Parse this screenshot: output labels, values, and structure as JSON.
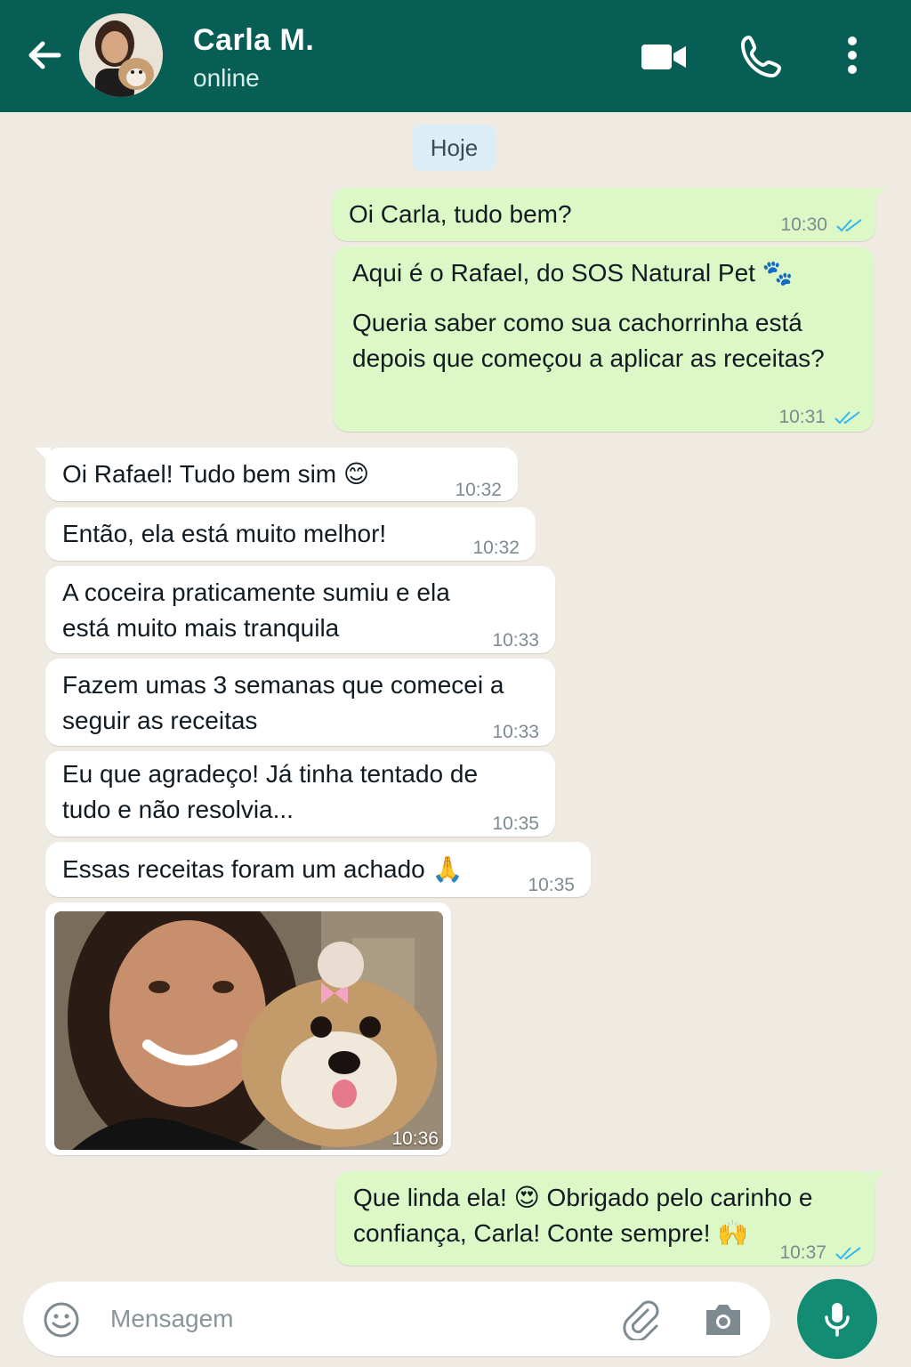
{
  "header": {
    "contact_name": "Carla M.",
    "status": "online"
  },
  "chat": {
    "date_chip": "Hoje",
    "messages": [
      {
        "dir": "out",
        "text": "Oi Carla, tudo bem?",
        "time": "10:30"
      },
      {
        "dir": "out",
        "line1": "Aqui é o Rafael, do SOS Natural Pet 🐾",
        "line2": "Queria saber como sua cachorrinha está depois que começou a aplicar as receitas?",
        "time": "10:31"
      },
      {
        "dir": "in",
        "text": "Oi Rafael! Tudo bem sim 😊",
        "time": "10:32"
      },
      {
        "dir": "in",
        "text": "Então, ela está muito melhor!",
        "time": "10:32"
      },
      {
        "dir": "in",
        "text": "A coceira praticamente sumiu e ela está muito mais tranquila",
        "time": "10:33"
      },
      {
        "dir": "in",
        "text": "Fazem umas 3 semanas que comecei a seguir as receitas",
        "time": "10:33"
      },
      {
        "dir": "in",
        "text": "Eu que agradeço! Já tinha tentado de tudo e não resolvia...",
        "time": "10:35"
      },
      {
        "dir": "in",
        "text": "Essas receitas foram um achado 🙏",
        "time": "10:35"
      },
      {
        "dir": "in",
        "type": "photo",
        "time": "10:36"
      },
      {
        "dir": "out",
        "text": "Que linda ela! 😍  Obrigado pelo carinho e confiança, Carla! Conte sempre! 🙌",
        "time": "10:37"
      }
    ]
  },
  "composer": {
    "placeholder": "Mensagem"
  },
  "colors": {
    "header": "#075e54",
    "outgoing_bubble": "#dcf8c6",
    "incoming_bubble": "#ffffff",
    "chat_bg": "#efeae2",
    "mic_button": "#128c73",
    "read_ticks": "#34b7f1"
  },
  "icons": [
    "back-arrow-icon",
    "video-call-icon",
    "phone-icon",
    "more-vert-icon",
    "double-check-icon",
    "emoji-icon",
    "attach-icon",
    "camera-icon",
    "mic-icon"
  ]
}
